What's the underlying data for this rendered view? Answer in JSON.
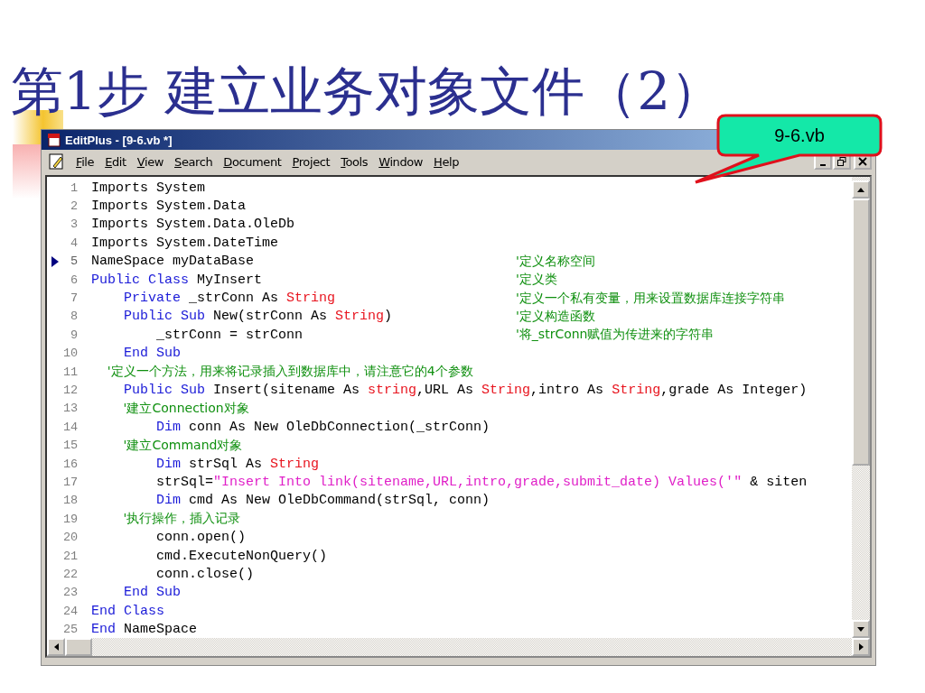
{
  "slide": {
    "title": "第1步 建立业务对象文件（2）",
    "callout": "9-6.vb"
  },
  "window": {
    "title": "EditPlus - [9-6.vb *]"
  },
  "menu": [
    {
      "label": "File"
    },
    {
      "label": "Edit"
    },
    {
      "label": "View"
    },
    {
      "label": "Search"
    },
    {
      "label": "Document"
    },
    {
      "label": "Project"
    },
    {
      "label": "Tools"
    },
    {
      "label": "Window"
    },
    {
      "label": "Help"
    }
  ],
  "editor": {
    "lines": [
      {
        "number": "1",
        "bookmarked": false,
        "tokens": [
          {
            "kind": "plain",
            "text": "Imports System"
          }
        ]
      },
      {
        "number": "2",
        "bookmarked": false,
        "tokens": [
          {
            "kind": "plain",
            "text": "Imports System.Data"
          }
        ]
      },
      {
        "number": "3",
        "bookmarked": false,
        "tokens": [
          {
            "kind": "plain",
            "text": "Imports System.Data.OleDb"
          }
        ]
      },
      {
        "number": "4",
        "bookmarked": false,
        "tokens": [
          {
            "kind": "plain",
            "text": "Imports System.DateTime"
          }
        ]
      },
      {
        "number": "5",
        "bookmarked": true,
        "tokens": [
          {
            "kind": "plain",
            "text": "NameSpace myDataBase"
          }
        ],
        "remark": "'定义名称空间"
      },
      {
        "number": "6",
        "bookmarked": false,
        "tokens": [
          {
            "kind": "keyword",
            "text": "Public Class"
          },
          {
            "kind": "plain",
            "text": " MyInsert"
          }
        ],
        "remark": "'定义类"
      },
      {
        "number": "7",
        "bookmarked": false,
        "tokens": [
          {
            "kind": "keyword",
            "text": "    Private"
          },
          {
            "kind": "plain",
            "text": " _strConn As "
          },
          {
            "kind": "type",
            "text": "String"
          }
        ],
        "remark": "'定义一个私有变量，用来设置数据库连接字符串"
      },
      {
        "number": "8",
        "bookmarked": false,
        "tokens": [
          {
            "kind": "keyword",
            "text": "    Public Sub"
          },
          {
            "kind": "plain",
            "text": " New(strConn As "
          },
          {
            "kind": "type",
            "text": "String"
          },
          {
            "kind": "plain",
            "text": ")"
          }
        ],
        "remark": "'定义构造函数"
      },
      {
        "number": "9",
        "bookmarked": false,
        "tokens": [
          {
            "kind": "plain",
            "text": "        _strConn = strConn"
          }
        ],
        "remark": "'将_strConn赋值为传进来的字符串"
      },
      {
        "number": "10",
        "bookmarked": false,
        "tokens": [
          {
            "kind": "keyword",
            "text": "    End Sub"
          }
        ]
      },
      {
        "number": "11",
        "bookmarked": false,
        "tokens": [
          {
            "kind": "comment",
            "text": "    '定义一个方法，用来将记录插入到数据库中，请注意它的4个参数"
          }
        ]
      },
      {
        "number": "12",
        "bookmarked": false,
        "tokens": [
          {
            "kind": "keyword",
            "text": "    Public Sub"
          },
          {
            "kind": "plain",
            "text": " Insert(sitename As "
          },
          {
            "kind": "type",
            "text": "string"
          },
          {
            "kind": "plain",
            "text": ",URL As "
          },
          {
            "kind": "type",
            "text": "String"
          },
          {
            "kind": "plain",
            "text": ",intro As "
          },
          {
            "kind": "type",
            "text": "String"
          },
          {
            "kind": "plain",
            "text": ",grade As Integer)"
          }
        ]
      },
      {
        "number": "13",
        "bookmarked": false,
        "tokens": [
          {
            "kind": "comment",
            "text": "        '建立Connection对象"
          }
        ]
      },
      {
        "number": "14",
        "bookmarked": false,
        "tokens": [
          {
            "kind": "keyword",
            "text": "        Dim"
          },
          {
            "kind": "plain",
            "text": " conn As New OleDbConnection(_strConn)"
          }
        ]
      },
      {
        "number": "15",
        "bookmarked": false,
        "tokens": [
          {
            "kind": "comment",
            "text": "        '建立Command对象"
          }
        ]
      },
      {
        "number": "16",
        "bookmarked": false,
        "tokens": [
          {
            "kind": "keyword",
            "text": "        Dim"
          },
          {
            "kind": "plain",
            "text": " strSql As "
          },
          {
            "kind": "type",
            "text": "String"
          }
        ]
      },
      {
        "number": "17",
        "bookmarked": false,
        "tokens": [
          {
            "kind": "plain",
            "text": "        strSql="
          },
          {
            "kind": "string",
            "text": "\"Insert Into link(sitename,URL,intro,grade,submit_date) Values('\""
          },
          {
            "kind": "plain",
            "text": " & siten"
          }
        ]
      },
      {
        "number": "18",
        "bookmarked": false,
        "tokens": [
          {
            "kind": "keyword",
            "text": "        Dim"
          },
          {
            "kind": "plain",
            "text": " cmd As New OleDbCommand(strSql, conn)"
          }
        ]
      },
      {
        "number": "19",
        "bookmarked": false,
        "tokens": [
          {
            "kind": "comment",
            "text": "        '执行操作，插入记录"
          }
        ]
      },
      {
        "number": "20",
        "bookmarked": false,
        "tokens": [
          {
            "kind": "plain",
            "text": "        conn.open()"
          }
        ]
      },
      {
        "number": "21",
        "bookmarked": false,
        "tokens": [
          {
            "kind": "plain",
            "text": "        cmd.ExecuteNonQuery()"
          }
        ]
      },
      {
        "number": "22",
        "bookmarked": false,
        "tokens": [
          {
            "kind": "plain",
            "text": "        conn.close()"
          }
        ]
      },
      {
        "number": "23",
        "bookmarked": false,
        "tokens": [
          {
            "kind": "keyword",
            "text": "    End Sub"
          }
        ]
      },
      {
        "number": "24",
        "bookmarked": false,
        "tokens": [
          {
            "kind": "keyword",
            "text": "End Class"
          }
        ]
      },
      {
        "number": "25",
        "bookmarked": false,
        "tokens": [
          {
            "kind": "keyword",
            "text": "End"
          },
          {
            "kind": "plain",
            "text": " NameSpace"
          }
        ]
      }
    ]
  }
}
